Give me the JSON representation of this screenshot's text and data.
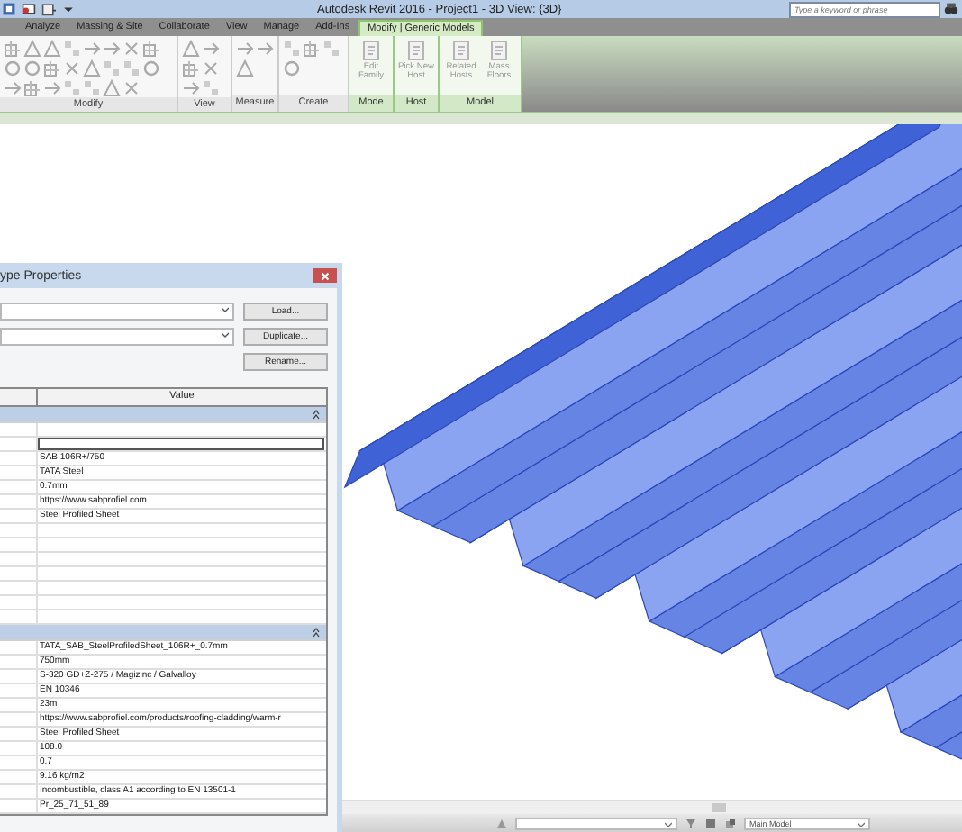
{
  "window": {
    "title": "Autodesk Revit 2016 - Project1 - 3D View: {3D}"
  },
  "search": {
    "placeholder": "Type a keyword or phrase"
  },
  "tabs": [
    {
      "label": "Analyze",
      "selected": false
    },
    {
      "label": "Massing & Site",
      "selected": false
    },
    {
      "label": "Collaborate",
      "selected": false
    },
    {
      "label": "View",
      "selected": false
    },
    {
      "label": "Manage",
      "selected": false
    },
    {
      "label": "Add-Ins",
      "selected": false
    },
    {
      "label": "Modify | Generic Models",
      "selected": true
    }
  ],
  "ribbon": {
    "panels": [
      {
        "label": "Modify",
        "kind": "modify"
      },
      {
        "label": "View",
        "kind": "view"
      },
      {
        "label": "Measure",
        "kind": "measure"
      },
      {
        "label": "Create",
        "kind": "create"
      },
      {
        "label": "Mode",
        "kind": "buttons",
        "buttons": [
          {
            "label": "Edit Family",
            "disabled": true
          }
        ]
      },
      {
        "label": "Host",
        "kind": "buttons",
        "buttons": [
          {
            "label": "Pick New Host",
            "disabled": true
          }
        ]
      },
      {
        "label": "Model",
        "kind": "buttons",
        "buttons": [
          {
            "label": "Related Hosts",
            "disabled": true
          },
          {
            "label": "Mass Floors",
            "disabled": true
          }
        ]
      }
    ]
  },
  "dialog": {
    "title": "ype Properties",
    "buttons": [
      "Load...",
      "Duplicate...",
      "Rename..."
    ],
    "columns": [
      "Value"
    ],
    "groups": [
      {
        "expanded": true,
        "rows": [
          {
            "kind": "text"
          },
          {
            "kind": "field"
          },
          {
            "kind": "text",
            "value": "SAB 106R+/750"
          },
          {
            "kind": "text",
            "value": "TATA Steel"
          },
          {
            "kind": "text",
            "value": "0.7mm"
          },
          {
            "kind": "text",
            "value": "https://www.sabprofiel.com"
          },
          {
            "kind": "text",
            "value": "Steel Profiled Sheet"
          },
          {
            "kind": "text"
          },
          {
            "kind": "text"
          },
          {
            "kind": "text"
          },
          {
            "kind": "text"
          },
          {
            "kind": "text"
          },
          {
            "kind": "text"
          },
          {
            "kind": "text"
          }
        ]
      },
      {
        "expanded": true,
        "rows": [
          {
            "kind": "text",
            "value": "TATA_SAB_SteelProfiledSheet_106R+_0.7mm"
          },
          {
            "kind": "text",
            "value": "750mm"
          },
          {
            "kind": "text",
            "value": "S-320 GD+Z-275 / Magizinc / Galvalloy"
          },
          {
            "kind": "text",
            "value": "EN 10346"
          },
          {
            "kind": "text",
            "value": "23m"
          },
          {
            "kind": "text",
            "value": "https://www.sabprofiel.com/products/roofing-cladding/warm-r"
          },
          {
            "kind": "text",
            "value": "Steel Profiled Sheet"
          },
          {
            "kind": "text",
            "value": "108.0"
          },
          {
            "kind": "text",
            "value": "0.7"
          },
          {
            "kind": "text",
            "value": "9.16 kg/m2"
          },
          {
            "kind": "text",
            "value": "Incombustible, class A1 according to EN 13501-1"
          },
          {
            "kind": "text",
            "value": "Pr_25_71_51_89"
          }
        ]
      }
    ]
  },
  "status_bar": {
    "model": "Main Model"
  }
}
